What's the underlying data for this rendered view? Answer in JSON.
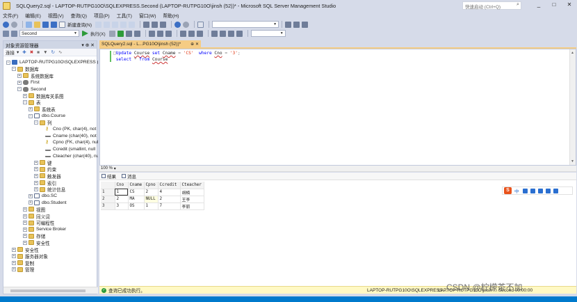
{
  "window": {
    "title": "SQLQuery2.sql - LAPTOP-RUTPG10O\\SQLEXPRESS.Second (LAPTOP-RUTPG10O\\jinsh (52))* - Microsoft SQL Server Management Studio",
    "quick_launch_placeholder": "快速启动 (Ctrl+Q)",
    "buttons": {
      "minimize": "_",
      "maximize": "□",
      "close": "✕"
    }
  },
  "menu": [
    "文件(F)",
    "编辑(E)",
    "视图(V)",
    "查询(Q)",
    "项目(P)",
    "工具(T)",
    "窗口(W)",
    "帮助(H)"
  ],
  "toolbar": {
    "new_query": "新建查询(N)",
    "database": "Second",
    "execute": "执行(X)"
  },
  "object_explorer": {
    "title": "对象资源管理器",
    "connect": "连接",
    "tree": [
      {
        "level": 0,
        "exp": "−",
        "icon": "server",
        "label": "LAPTOP-RUTPG10O\\SQLEXPRESS (SC"
      },
      {
        "level": 1,
        "exp": "−",
        "icon": "folder",
        "label": "数据库"
      },
      {
        "level": 2,
        "exp": "+",
        "icon": "folder",
        "label": "系统数据库"
      },
      {
        "level": 2,
        "exp": "+",
        "icon": "db",
        "label": "First"
      },
      {
        "level": 2,
        "exp": "−",
        "icon": "db",
        "label": "Second"
      },
      {
        "level": 3,
        "exp": "+",
        "icon": "folder",
        "label": "数据库关系图"
      },
      {
        "level": 3,
        "exp": "−",
        "icon": "folder",
        "label": "表"
      },
      {
        "level": 4,
        "exp": "+",
        "icon": "folder",
        "label": "系统表"
      },
      {
        "level": 4,
        "exp": "−",
        "icon": "table",
        "label": "dbo.Course"
      },
      {
        "level": 5,
        "exp": "−",
        "icon": "folder",
        "label": "列"
      },
      {
        "level": 6,
        "exp": "",
        "icon": "key",
        "label": "Cno (PK, char(4), not"
      },
      {
        "level": 6,
        "exp": "",
        "icon": "col",
        "label": "Cname (char(40), not"
      },
      {
        "level": 6,
        "exp": "",
        "icon": "key",
        "label": "Cpno (FK, char(4), nul"
      },
      {
        "level": 6,
        "exp": "",
        "icon": "col",
        "label": "Ccredit (smallint, null"
      },
      {
        "level": 6,
        "exp": "",
        "icon": "col",
        "label": "Cteacher (char(40), nu"
      },
      {
        "level": 5,
        "exp": "+",
        "icon": "folder",
        "label": "键"
      },
      {
        "level": 5,
        "exp": "+",
        "icon": "folder",
        "label": "约束"
      },
      {
        "level": 5,
        "exp": "+",
        "icon": "folder",
        "label": "触发器"
      },
      {
        "level": 5,
        "exp": "+",
        "icon": "folder",
        "label": "索引"
      },
      {
        "level": 5,
        "exp": "+",
        "icon": "folder",
        "label": "统计信息"
      },
      {
        "level": 4,
        "exp": "+",
        "icon": "table",
        "label": "dbo.SC"
      },
      {
        "level": 4,
        "exp": "+",
        "icon": "table",
        "label": "dbo.Student"
      },
      {
        "level": 3,
        "exp": "+",
        "icon": "folder",
        "label": "视图"
      },
      {
        "level": 3,
        "exp": "+",
        "icon": "folder",
        "label": "同义词"
      },
      {
        "level": 3,
        "exp": "+",
        "icon": "folder",
        "label": "可编程性"
      },
      {
        "level": 3,
        "exp": "+",
        "icon": "folder",
        "label": "Service Broker"
      },
      {
        "level": 3,
        "exp": "+",
        "icon": "folder",
        "label": "存储"
      },
      {
        "level": 3,
        "exp": "+",
        "icon": "folder",
        "label": "安全性"
      },
      {
        "level": 1,
        "exp": "+",
        "icon": "folder",
        "label": "安全性"
      },
      {
        "level": 1,
        "exp": "+",
        "icon": "folder",
        "label": "服务器对象"
      },
      {
        "level": 1,
        "exp": "+",
        "icon": "folder",
        "label": "复制"
      },
      {
        "level": 1,
        "exp": "+",
        "icon": "folder",
        "label": "管理"
      }
    ]
  },
  "editor": {
    "tab_title": "SQLQuery2.sql - L...PG10O\\jinsh (52))*",
    "tab_pin": "⊕",
    "tab_close": "✕",
    "line1": {
      "kw1": "Update",
      "t1": "Course",
      "kw2": "set",
      "col1": "Cname",
      "eq1": "=",
      "v1": "'CS'",
      "kw3": "where",
      "col2": "Cno",
      "eq2": "=",
      "v2": "'3'",
      "end": ";"
    },
    "line2": {
      "kw1": "select",
      "star": "*",
      "kw2": "from",
      "t1": "Course"
    },
    "zoom": "100 %"
  },
  "results": {
    "tab_results": "结果",
    "tab_messages": "消息",
    "columns": [
      "",
      "Cno",
      "Cname",
      "Cpno",
      "Ccredit",
      "Cteacher"
    ],
    "rows": [
      [
        "1",
        "1",
        "CS",
        "2",
        "4",
        "胡楠"
      ],
      [
        "2",
        "2",
        "MA",
        "NULL",
        "2",
        "王李"
      ],
      [
        "3",
        "3",
        "OS",
        "1",
        "7",
        "李丽"
      ]
    ]
  },
  "ime": {
    "logo": "S",
    "lang": "中"
  },
  "status": {
    "message": "查询已成功执行。",
    "server": "LAPTOP-RUTPG10O\\SQLEXPRESS ...",
    "right": "LAPTOP-RUTPG10O\\jinsh ... Second 00:00:00"
  },
  "watermark": "CSDN @柠檬茶不加"
}
